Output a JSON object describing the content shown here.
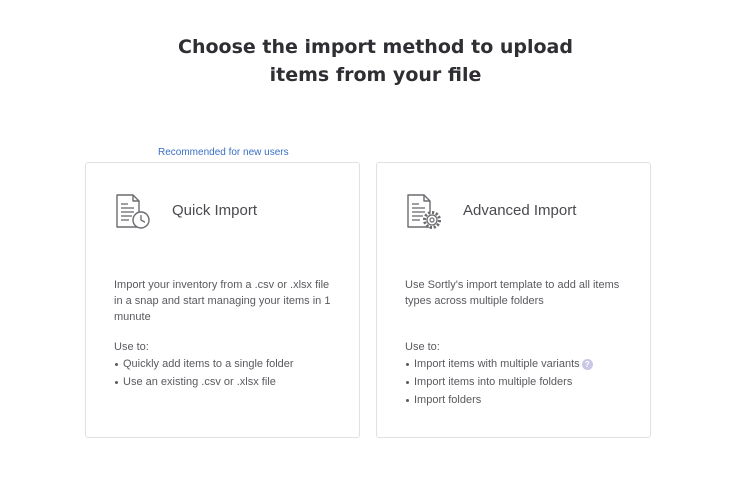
{
  "page": {
    "heading_line1": "Choose the import method to upload",
    "heading_line2": "items from your file",
    "recommended_label": "Recommended for new users"
  },
  "cards": {
    "quick": {
      "icon": "document-clock-icon",
      "title": "Quick Import",
      "description": "Import your inventory from a .csv or .xlsx file in a snap and start managing your items in 1 munute",
      "use_to_label": "Use to:",
      "bullets": [
        "Quickly add items to a single folder",
        "Use an existing .csv or .xlsx file"
      ]
    },
    "advanced": {
      "icon": "document-gear-icon",
      "title": "Advanced Import",
      "description": "Use Sortly's import template to add all items types across multiple folders",
      "use_to_label": "Use to:",
      "bullets": [
        "Import items with multiple variants",
        "Import items into multiple folders",
        "Import folders"
      ],
      "help_icon": "?"
    }
  },
  "colors": {
    "heading": "#2e2e33",
    "link_blue": "#3a6fc4",
    "card_border": "#e1e1e4",
    "help_icon_bg": "#c9c6e6"
  }
}
